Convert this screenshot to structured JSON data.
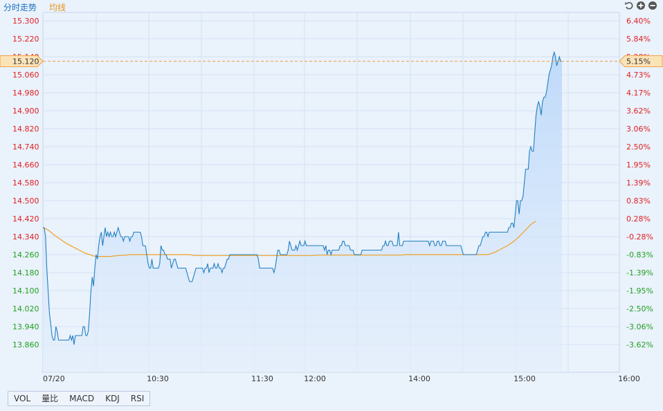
{
  "tabs": {
    "trend_label": "分时走势",
    "avg_label": "均线"
  },
  "controls": {
    "reset_icon": "reset-icon",
    "zoom_in_icon": "zoom-in-icon",
    "zoom_out_icon": "zoom-out-icon"
  },
  "indicators": [
    "VOL",
    "量比",
    "MACD",
    "KDJ",
    "RSI"
  ],
  "colors": {
    "price_line": "#1f7fc0",
    "avg_line": "#f0a020",
    "area_fill": "#cfe3fb",
    "up_text": "#e02020",
    "down_text": "#20a020",
    "grid": "#d2e2f3",
    "marker": "#f2a040"
  },
  "chart_data": {
    "type": "line",
    "x_ticks": [
      "07/20",
      "10:30",
      "11:30",
      "12:00",
      "14:00",
      "15:00",
      "16:00"
    ],
    "y_ticks": [
      "15.300",
      "15.220",
      "15.140",
      "15.060",
      "14.980",
      "14.900",
      "14.820",
      "14.740",
      "14.660",
      "14.580",
      "14.500",
      "14.420",
      "14.340",
      "14.260",
      "14.180",
      "14.100",
      "14.020",
      "13.940",
      "13.860"
    ],
    "pct_ticks": [
      "6.40%",
      "5.84%",
      "5.28%",
      "4.73%",
      "4.17%",
      "3.62%",
      "3.06%",
      "2.50%",
      "1.95%",
      "1.39%",
      "0.83%",
      "0.28%",
      "-0.28%",
      "-0.83%",
      "-1.39%",
      "-1.95%",
      "-2.50%",
      "-3.06%",
      "-3.62%"
    ],
    "ylim": [
      13.82,
      15.32
    ],
    "pct_lim": [
      -3.9,
      6.68
    ],
    "current_price_label": "15.120",
    "current_pct_label": "5.15%",
    "current_price": 15.12,
    "price_series": [
      14.38,
      14.38,
      14.34,
      14.2,
      14.1,
      14.0,
      13.95,
      13.9,
      13.88,
      13.88,
      13.94,
      13.92,
      13.88,
      13.88,
      13.88,
      13.88,
      13.88,
      13.88,
      13.88,
      13.88,
      13.88,
      13.9,
      13.88,
      13.9,
      13.86,
      13.9,
      13.9,
      13.9,
      13.9,
      13.9,
      13.9,
      13.94,
      13.94,
      13.9,
      13.9,
      13.92,
      14.0,
      14.1,
      14.16,
      14.12,
      14.2,
      14.26,
      14.24,
      14.3,
      14.34,
      14.36,
      14.3,
      14.34,
      14.38,
      14.34,
      14.36,
      14.34,
      14.36,
      14.34,
      14.34,
      14.36,
      14.34,
      14.36,
      14.38,
      14.36,
      14.34,
      14.34,
      14.32,
      14.34,
      14.34,
      14.34,
      14.34,
      14.32,
      14.34,
      14.34,
      14.36,
      14.36,
      14.36,
      14.36,
      14.36,
      14.36,
      14.34,
      14.3,
      14.3,
      14.3,
      14.26,
      14.22,
      14.2,
      14.2,
      14.24,
      14.2,
      14.2,
      14.2,
      14.2,
      14.2,
      14.22,
      14.3,
      14.28,
      14.28,
      14.26,
      14.26,
      14.24,
      14.24,
      14.24,
      14.2,
      14.22,
      14.24,
      14.24,
      14.22,
      14.2,
      14.2,
      14.2,
      14.2,
      14.2,
      14.2,
      14.2,
      14.18,
      14.16,
      14.14,
      14.14,
      14.14,
      14.16,
      14.18,
      14.2,
      14.2,
      14.2,
      14.2,
      14.2,
      14.2,
      14.18,
      14.2,
      14.2,
      14.22,
      14.18,
      14.2,
      14.2,
      14.2,
      14.22,
      14.2,
      14.2,
      14.22,
      14.2,
      14.2,
      14.18,
      14.2,
      14.2,
      14.22,
      14.24,
      14.24,
      14.26,
      14.26,
      14.26,
      14.26,
      14.26,
      14.26,
      14.26,
      14.26,
      14.26,
      14.26,
      14.26,
      14.26,
      14.26,
      14.26,
      14.26,
      14.26,
      14.26,
      14.26,
      14.26,
      14.26,
      14.26,
      14.26,
      14.24,
      14.2,
      14.2,
      14.2,
      14.2,
      14.2,
      14.2,
      14.2,
      14.2,
      14.2,
      14.2,
      14.2,
      14.18,
      14.2,
      14.24,
      14.28,
      14.28,
      14.26,
      14.26,
      14.26,
      14.26,
      14.26,
      14.26,
      14.28,
      14.32,
      14.3,
      14.28,
      14.28,
      14.28,
      14.3,
      14.28,
      14.3,
      14.32,
      14.3,
      14.3,
      14.3,
      14.32,
      14.3,
      14.3,
      14.3,
      14.3,
      14.3,
      14.3,
      14.3,
      14.3,
      14.3,
      14.3,
      14.3,
      14.3,
      14.3,
      14.3,
      14.28,
      14.3,
      14.26,
      14.28,
      14.28,
      14.26,
      14.28,
      14.28,
      14.28,
      14.28,
      14.28,
      14.28,
      14.3,
      14.3,
      14.32,
      14.32,
      14.3,
      14.3,
      14.3,
      14.3,
      14.28,
      14.28,
      14.28,
      14.26,
      14.26,
      14.26,
      14.26,
      14.26,
      14.26,
      14.28,
      14.28,
      14.28,
      14.28,
      14.28,
      14.28,
      14.28,
      14.28,
      14.28,
      14.28,
      14.28,
      14.28,
      14.28,
      14.28,
      14.28,
      14.28,
      14.3,
      14.3,
      14.32,
      14.3,
      14.3,
      14.32,
      14.32,
      14.32,
      14.3,
      14.3,
      14.3,
      14.3,
      14.36,
      14.3,
      14.3,
      14.3,
      14.32,
      14.32,
      14.32,
      14.32,
      14.32,
      14.32,
      14.32,
      14.32,
      14.32,
      14.32,
      14.32,
      14.32,
      14.32,
      14.32,
      14.32,
      14.32,
      14.32,
      14.32,
      14.32,
      14.32,
      14.3,
      14.32,
      14.32,
      14.32,
      14.3,
      14.3,
      14.32,
      14.32,
      14.3,
      14.3,
      14.32,
      14.32,
      14.32,
      14.3,
      14.3,
      14.3,
      14.3,
      14.3,
      14.3,
      14.3,
      14.3,
      14.3,
      14.3,
      14.3,
      14.3,
      14.28,
      14.26,
      14.26,
      14.26,
      14.26,
      14.26,
      14.26,
      14.26,
      14.26,
      14.26,
      14.26,
      14.26,
      14.28,
      14.3,
      14.3,
      14.32,
      14.34,
      14.34,
      14.36,
      14.36,
      14.34,
      14.36,
      14.36,
      14.36,
      14.36,
      14.36,
      14.36,
      14.36,
      14.36,
      14.36,
      14.36,
      14.36,
      14.36,
      14.36,
      14.36,
      14.36,
      14.38,
      14.38,
      14.4,
      14.4,
      14.38,
      14.44,
      14.5,
      14.5,
      14.44,
      14.5,
      14.5,
      14.52,
      14.58,
      14.64,
      14.64,
      14.64,
      14.72,
      14.74,
      14.72,
      14.72,
      14.8,
      14.88,
      14.92,
      14.94,
      14.92,
      14.88,
      14.94,
      14.96,
      14.96,
      14.98,
      15.02,
      15.06,
      15.08,
      15.1,
      15.14,
      15.16,
      15.14,
      15.1,
      15.12,
      15.14,
      15.12,
      15.12
    ],
    "avg_series": [
      14.38,
      14.378,
      14.376,
      14.372,
      14.37,
      14.365,
      14.36,
      14.356,
      14.35,
      14.346,
      14.342,
      14.338,
      14.334,
      14.33,
      14.326,
      14.322,
      14.318,
      14.314,
      14.31,
      14.307,
      14.304,
      14.301,
      14.298,
      14.295,
      14.292,
      14.289,
      14.286,
      14.283,
      14.28,
      14.277,
      14.274,
      14.271,
      14.268,
      14.266,
      14.264,
      14.262,
      14.26,
      14.258,
      14.256,
      14.254,
      14.253,
      14.253,
      14.252,
      14.252,
      14.252,
      14.252,
      14.252,
      14.252,
      14.252,
      14.252,
      14.252,
      14.252,
      14.252,
      14.253,
      14.254,
      14.254,
      14.254,
      14.255,
      14.256,
      14.256,
      14.256,
      14.257,
      14.258,
      14.258,
      14.258,
      14.258,
      14.259,
      14.26,
      14.26,
      14.26,
      14.26,
      14.26,
      14.26,
      14.26,
      14.26,
      14.26,
      14.26,
      14.26,
      14.26,
      14.26,
      14.26,
      14.26,
      14.26,
      14.26,
      14.26,
      14.26,
      14.26,
      14.26,
      14.26,
      14.26,
      14.26,
      14.26,
      14.26,
      14.26,
      14.26,
      14.26,
      14.26,
      14.26,
      14.26,
      14.26,
      14.26,
      14.26,
      14.26,
      14.26,
      14.26,
      14.26,
      14.26,
      14.26,
      14.26,
      14.26,
      14.26,
      14.26,
      14.26,
      14.26,
      14.259,
      14.258,
      14.257,
      14.256,
      14.256,
      14.256,
      14.256,
      14.256,
      14.256,
      14.256,
      14.256,
      14.256,
      14.256,
      14.256,
      14.256,
      14.256,
      14.256,
      14.256,
      14.256,
      14.256,
      14.256,
      14.256,
      14.256,
      14.256,
      14.256,
      14.256,
      14.256,
      14.256,
      14.256,
      14.256,
      14.256,
      14.256,
      14.256,
      14.256,
      14.256,
      14.256,
      14.256,
      14.256,
      14.256,
      14.256,
      14.256,
      14.256,
      14.256,
      14.256,
      14.256,
      14.256,
      14.256,
      14.256,
      14.256,
      14.256,
      14.256,
      14.256,
      14.256,
      14.256,
      14.256,
      14.256,
      14.256,
      14.256,
      14.256,
      14.256,
      14.256,
      14.256,
      14.256,
      14.256,
      14.256,
      14.256,
      14.256,
      14.256,
      14.256,
      14.256,
      14.256,
      14.256,
      14.256,
      14.256,
      14.256,
      14.256,
      14.256,
      14.256,
      14.256,
      14.256,
      14.256,
      14.256,
      14.256,
      14.256,
      14.256,
      14.256,
      14.256,
      14.256,
      14.256,
      14.256,
      14.256,
      14.256,
      14.256,
      14.256,
      14.256,
      14.256,
      14.257,
      14.258,
      14.258,
      14.258,
      14.258,
      14.258,
      14.258,
      14.258,
      14.258,
      14.258,
      14.258,
      14.258,
      14.258,
      14.258,
      14.258,
      14.258,
      14.258,
      14.258,
      14.258,
      14.258,
      14.258,
      14.258,
      14.258,
      14.258,
      14.258,
      14.258,
      14.258,
      14.258,
      14.258,
      14.258,
      14.258,
      14.258,
      14.258,
      14.258,
      14.258,
      14.258,
      14.258,
      14.258,
      14.258,
      14.258,
      14.258,
      14.258,
      14.258,
      14.258,
      14.258,
      14.258,
      14.258,
      14.258,
      14.258,
      14.258,
      14.258,
      14.258,
      14.258,
      14.258,
      14.258,
      14.258,
      14.258,
      14.258,
      14.258,
      14.258,
      14.258,
      14.258,
      14.258,
      14.258,
      14.258,
      14.258,
      14.258,
      14.258,
      14.259,
      14.26,
      14.26,
      14.26,
      14.26,
      14.26,
      14.26,
      14.26,
      14.26,
      14.26,
      14.26,
      14.26,
      14.26,
      14.26,
      14.26,
      14.26,
      14.26,
      14.26,
      14.26,
      14.26,
      14.26,
      14.26,
      14.26,
      14.26,
      14.26,
      14.26,
      14.26,
      14.26,
      14.26,
      14.26,
      14.26,
      14.26,
      14.26,
      14.26,
      14.26,
      14.26,
      14.26,
      14.26,
      14.26,
      14.26,
      14.26,
      14.26,
      14.26,
      14.26,
      14.26,
      14.26,
      14.26,
      14.26,
      14.26,
      14.26,
      14.26,
      14.26,
      14.26,
      14.26,
      14.26,
      14.26,
      14.26,
      14.26,
      14.26,
      14.26,
      14.26,
      14.26,
      14.26,
      14.26,
      14.26,
      14.26,
      14.262,
      14.264,
      14.266,
      14.268,
      14.27,
      14.273,
      14.276,
      14.279,
      14.282,
      14.285,
      14.288,
      14.291,
      14.294,
      14.297,
      14.3,
      14.304,
      14.308,
      14.312,
      14.316,
      14.32,
      14.325,
      14.33,
      14.335,
      14.34,
      14.346,
      14.352,
      14.358,
      14.364,
      14.37,
      14.376,
      14.382,
      14.388,
      14.394,
      14.398,
      14.402,
      14.406,
      14.408
    ],
    "x_axis_label": "",
    "y_axis_label": "",
    "grid": true
  }
}
